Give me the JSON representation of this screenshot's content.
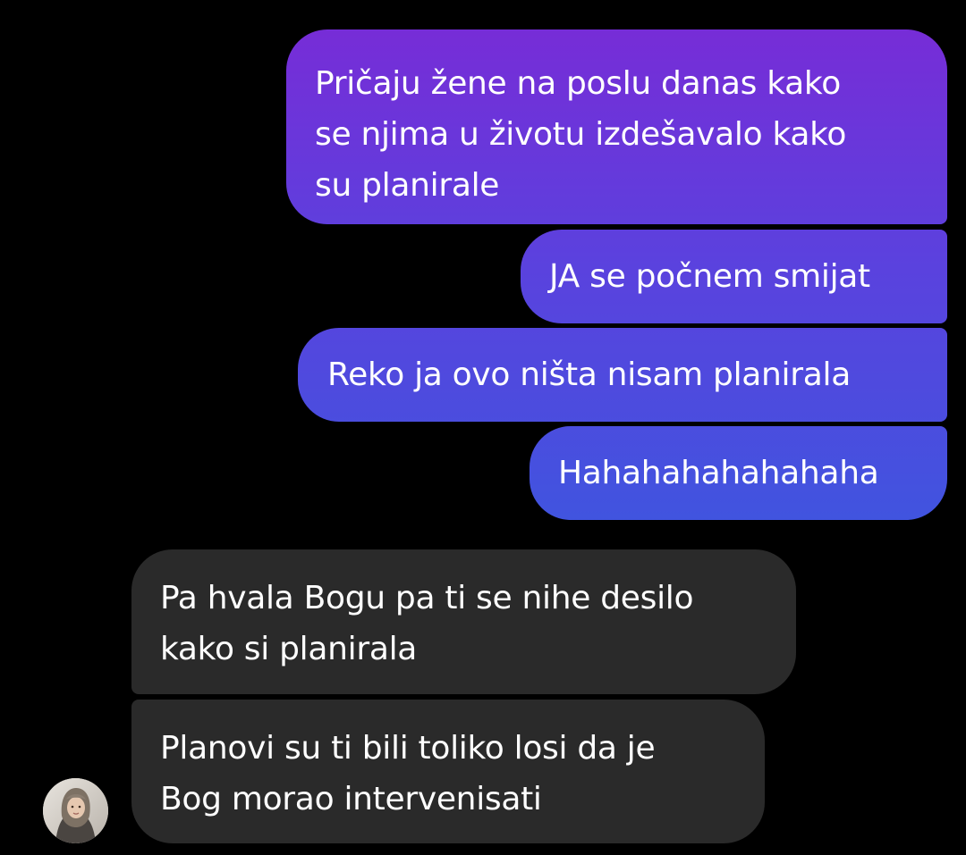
{
  "messages": [
    {
      "direction": "outgoing",
      "lines": [
        "Pričaju žene na poslu danas kako",
        "se njima u životu izdešavalo kako",
        "su planirale"
      ]
    },
    {
      "direction": "outgoing",
      "lines": [
        "JA se počnem smijat"
      ]
    },
    {
      "direction": "outgoing",
      "lines": [
        "Reko ja ovo ništa nisam planirala"
      ]
    },
    {
      "direction": "outgoing",
      "lines": [
        "Hahahahahahahaha"
      ]
    },
    {
      "direction": "incoming",
      "lines": [
        "Pa hvala Bogu pa ti se nihe desilo",
        "kako si planirala"
      ]
    },
    {
      "direction": "incoming",
      "lines": [
        "Planovi su ti bili toliko losi da je",
        "Bog morao intervenisati"
      ]
    }
  ],
  "colors": {
    "background": "#000000",
    "outgoing_top": "#7a2ad6",
    "outgoing_bottom": "#3f55df",
    "incoming_bubble": "#2a2a2a",
    "text": "#ffffff"
  },
  "avatar": {
    "icon": "contact-avatar-photo"
  }
}
